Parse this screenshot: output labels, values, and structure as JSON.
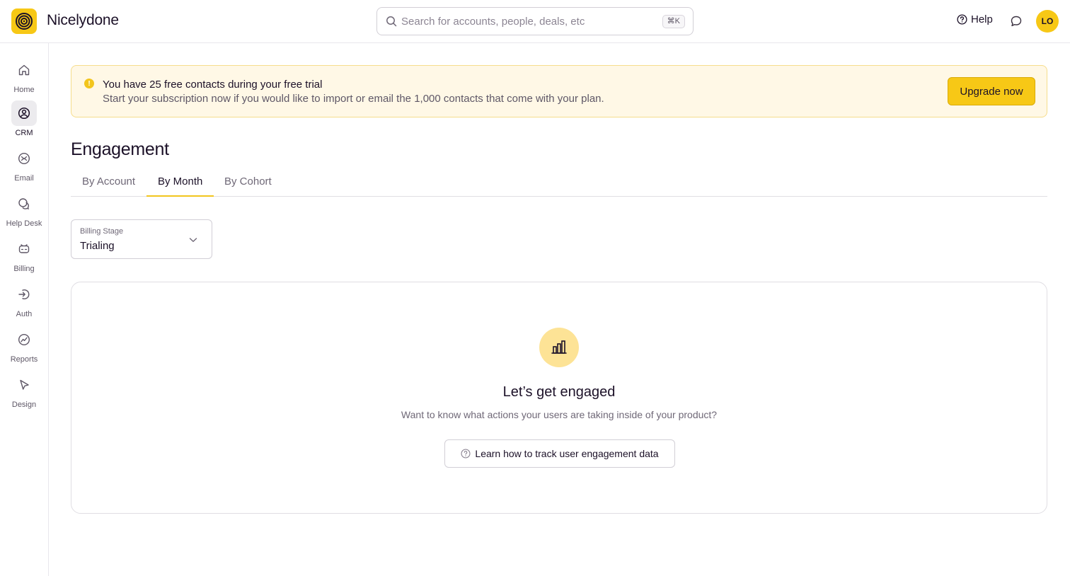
{
  "app": {
    "name": "Nicelydone"
  },
  "header": {
    "search": {
      "placeholder": "Search for accounts, people, deals, etc",
      "shortcut": "⌘K"
    },
    "help_label": "Help",
    "avatar_initials": "LO"
  },
  "sidebar": {
    "items": [
      {
        "label": "Home",
        "icon": "home-icon",
        "active": false
      },
      {
        "label": "CRM",
        "icon": "user-circle-icon",
        "active": true
      },
      {
        "label": "Email",
        "icon": "mail-icon",
        "active": false
      },
      {
        "label": "Help Desk",
        "icon": "chat-bubbles-icon",
        "active": false
      },
      {
        "label": "Billing",
        "icon": "billing-icon",
        "active": false
      },
      {
        "label": "Auth",
        "icon": "login-icon",
        "active": false
      },
      {
        "label": "Reports",
        "icon": "chart-line-icon",
        "active": false
      },
      {
        "label": "Design",
        "icon": "cursor-icon",
        "active": false
      }
    ]
  },
  "banner": {
    "title": "You have 25 free contacts during your free trial",
    "text": "Start your subscription now if you would like to import or email the 1,000 contacts that come with your plan.",
    "button_label": "Upgrade now"
  },
  "page": {
    "title": "Engagement",
    "tabs": [
      {
        "label": "By Account",
        "active": false
      },
      {
        "label": "By Month",
        "active": true
      },
      {
        "label": "By Cohort",
        "active": false
      }
    ],
    "filter": {
      "label": "Billing Stage",
      "value": "Trialing"
    }
  },
  "empty_state": {
    "icon": "bar-chart-icon",
    "title": "Let’s get engaged",
    "text": "Want to know what actions your users are taking inside of your product?",
    "button_label": "Learn how to track user engagement data"
  },
  "colors": {
    "accent": "#f7c816",
    "banner_bg": "#fff8e6",
    "text": "#1c1128",
    "muted": "#6f6877"
  }
}
